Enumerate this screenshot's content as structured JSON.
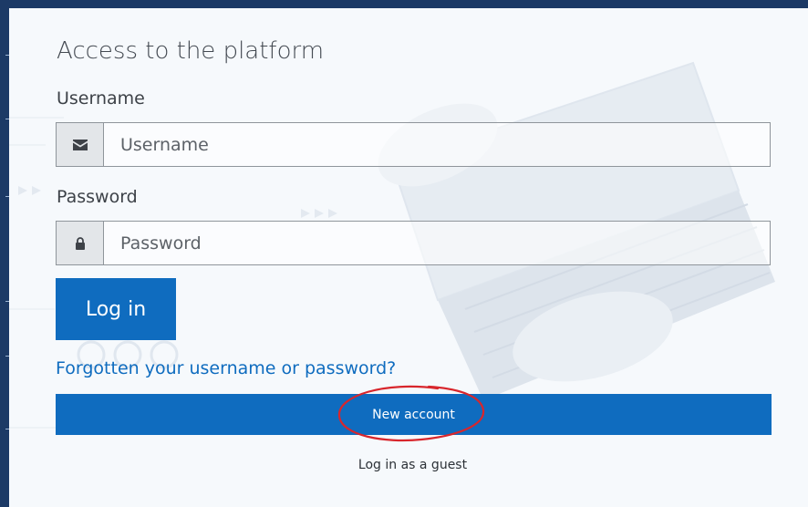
{
  "login": {
    "title": "Access to the platform",
    "username_label": "Username",
    "username_placeholder": "Username",
    "username_value": "",
    "username_icon": "envelope-icon",
    "password_label": "Password",
    "password_placeholder": "Password",
    "password_value": "",
    "password_icon": "lock-icon",
    "login_button": "Log in",
    "forgot_link": "Forgotten your username or password?",
    "new_account_button": "New account",
    "guest_button": "Log in as a guest"
  },
  "colors": {
    "primary": "#0f6cbf",
    "sidebar": "#1c3a66",
    "annotation": "#d8262c"
  }
}
